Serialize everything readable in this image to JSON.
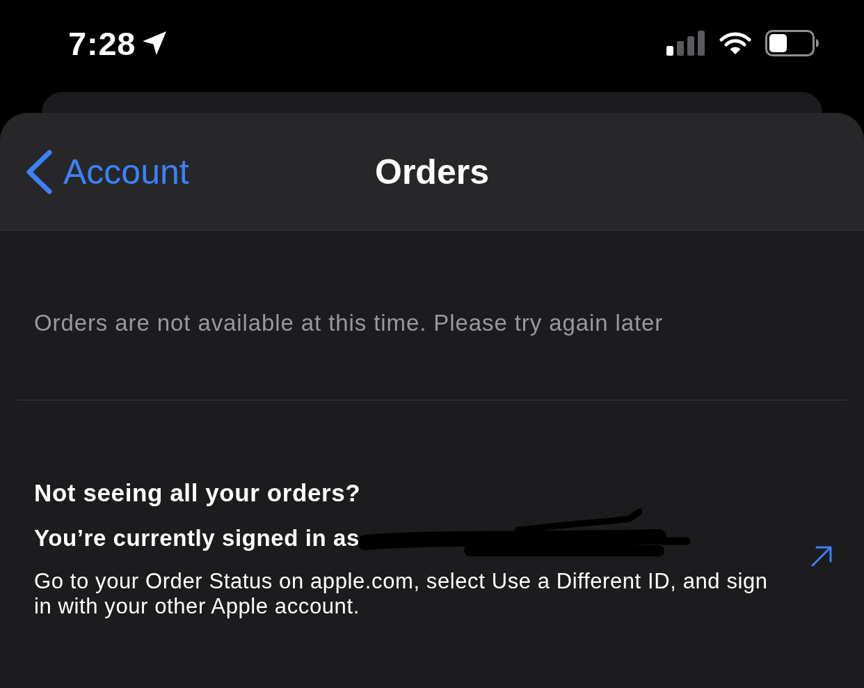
{
  "status_bar": {
    "time": "7:28"
  },
  "nav": {
    "back_label": "Account",
    "title": "Orders"
  },
  "message": "Orders are not available at this time. Please try again later",
  "help": {
    "heading": "Not seeing all your orders?",
    "signed_in": "You’re currently signed in as",
    "body": "Go to your Order Status on apple.com, select Use a Different ID, and sign in with your other Apple account."
  }
}
